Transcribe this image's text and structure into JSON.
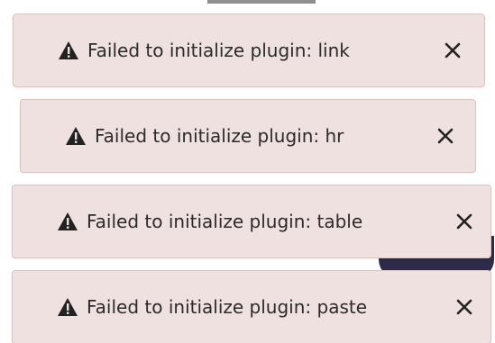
{
  "notifications": [
    {
      "icon": "warning-icon",
      "message": "Failed to initialize plugin: link",
      "close_icon": "close-icon"
    },
    {
      "icon": "warning-icon",
      "message": "Failed to initialize plugin: hr",
      "close_icon": "close-icon"
    },
    {
      "icon": "warning-icon",
      "message": "Failed to initialize plugin: table",
      "close_icon": "close-icon"
    },
    {
      "icon": "warning-icon",
      "message": "Failed to initialize plugin: paste",
      "close_icon": "close-icon"
    }
  ],
  "colors": {
    "toast_background": "#efe1df",
    "toast_border": "#d8c4c1",
    "text": "#2b2b2b"
  }
}
